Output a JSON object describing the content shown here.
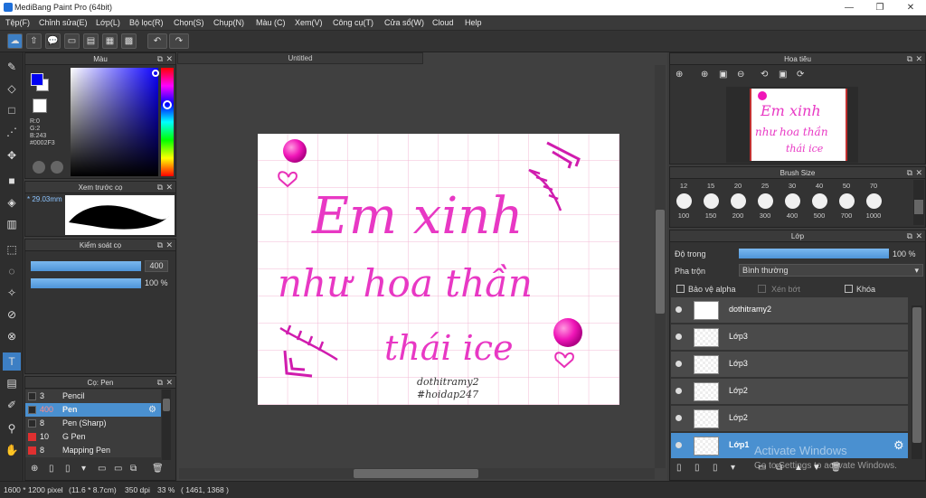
{
  "app": {
    "title": "MediBang Paint Pro (64bit)"
  },
  "menu": [
    "Tệp(F)",
    "Chỉnh sửa(E)",
    "Lớp(L)",
    "Bộ lọc(R)",
    "Chọn(S)",
    "Chụp(N)",
    "Màu (C)",
    "Xem(V)",
    "Công cụ(T)",
    "Cửa sổ(W)",
    "Cloud",
    "Help"
  ],
  "color_panel": {
    "title": "Màu",
    "r": "R:0",
    "g": "G:2",
    "b": "B:243",
    "hex": "#0002F3",
    "fg": "#0002f3",
    "bg": "#ffffff"
  },
  "brush_preview": {
    "title": "Xem trước cọ",
    "size": "29.03mm"
  },
  "brush_control": {
    "title": "Kiểm soát cọ",
    "size_value": "400",
    "opacity_value": "100 %"
  },
  "brush_list": {
    "title": "Cọ: Pen",
    "items": [
      {
        "size": "3",
        "name": "Pencil",
        "color": "#2a2a2a",
        "selected": false
      },
      {
        "size": "400",
        "name": "Pen",
        "color": "#2a2a2a",
        "selected": true
      },
      {
        "size": "8",
        "name": "Pen (Sharp)",
        "color": "#2a2a2a",
        "selected": false
      },
      {
        "size": "10",
        "name": "G Pen",
        "color": "#e03030",
        "selected": false
      },
      {
        "size": "8",
        "name": "Mapping Pen",
        "color": "#e03030",
        "selected": false
      }
    ]
  },
  "document": {
    "tab": "Untitled",
    "lines": [
      "Em xinh",
      "như hoa thần",
      "thái ice"
    ],
    "signature": [
      "dothitramy2",
      "#hoidap247"
    ]
  },
  "navigator": {
    "title": "Hoa tiêu"
  },
  "brush_size": {
    "title": "Brush Size",
    "top": [
      "12",
      "15",
      "20",
      "25",
      "30",
      "40",
      "50",
      "70"
    ],
    "bottom": [
      "100",
      "150",
      "200",
      "300",
      "400",
      "500",
      "700",
      "1000"
    ]
  },
  "layers": {
    "title": "Lớp",
    "opacity_label": "Độ trong",
    "opacity_value": "100 %",
    "blend_label": "Pha trộn",
    "blend_value": "Bình thường",
    "protect_alpha": "Bảo vệ alpha",
    "clipping": "Xén bớt",
    "lock": "Khóa",
    "items": [
      "dothitramy2",
      "Lớp3",
      "Lớp3",
      "Lớp2",
      "Lớp2",
      "Lớp1"
    ]
  },
  "watermark": {
    "line1": "Activate Windows",
    "line2": "Go to Settings to activate Windows."
  },
  "status": {
    "size": "1600 * 1200 pixel",
    "dims": "(11.6 * 8.7cm)",
    "dpi": "350 dpi",
    "zoom": "33 %",
    "coords": "( 1461, 1368 )"
  }
}
